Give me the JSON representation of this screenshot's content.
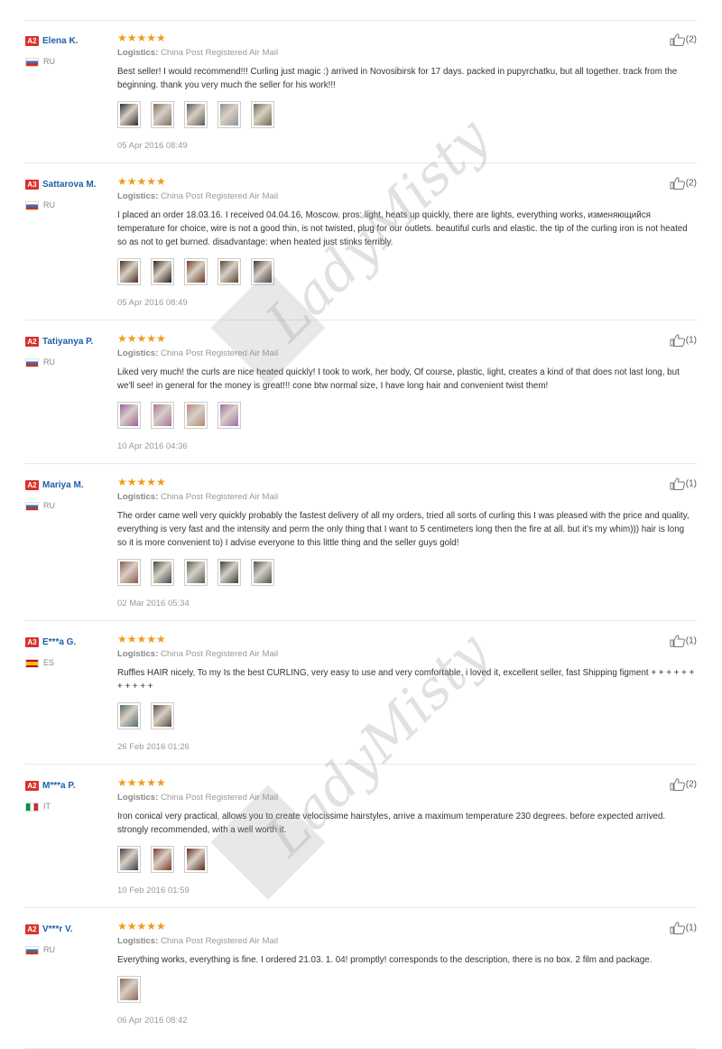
{
  "watermark_text": "LadyMisty",
  "reviews": [
    {
      "level": "A2",
      "name": "Elena K.",
      "country": "RU",
      "flag": "ru",
      "stars": "★★★★★",
      "logistics_label": "Logistics:",
      "logistics": "China Post Registered Air Mail",
      "text": "Best seller! I would recommend!!! Curling just magic :) arrived in Novosibirsk for 17 days. packed in pupyrchatku, but all together. track from the beginning. thank you very much the seller for his work!!!",
      "thumbs": [
        "#2d2d2a",
        "#7b7062",
        "#5e5a52",
        "#8e9499",
        "#6f6a4c"
      ],
      "date": "05 Apr 2016 08:49",
      "likes": "(2)"
    },
    {
      "level": "A3",
      "name": "Sattarova M.",
      "country": "RU",
      "flag": "ru",
      "stars": "★★★★★",
      "logistics_label": "Logistics:",
      "logistics": "China Post Registered Air Mail",
      "text": "I placed an order 18.03.16. I received 04.04.16, Moscow. pros: light, heats up quickly, there are lights, everything works, изменяющийся temperature for choice, wire is not a good thin, is not twisted, plug for our outlets. beautiful curls and elastic. the tip of the curling iron is not heated so as not to get burned. disadvantage: when heated just stinks terribly.",
      "thumbs": [
        "#4a3020",
        "#2a211c",
        "#6a3e26",
        "#5a4535",
        "#3a3436"
      ],
      "date": "05 Apr 2016 08:49",
      "likes": "(2)"
    },
    {
      "level": "A2",
      "name": "Tatiyanya P.",
      "country": "RU",
      "flag": "ru",
      "stars": "★★★★★",
      "logistics_label": "Logistics:",
      "logistics": "China Post Registered Air Mail",
      "text": "Liked very much! the curls are nice heated quickly! I took to work, her body, Of course, plastic, light, creates a kind of that does not last long, but we'll see! in general for the money is great!!! cone btw normal size, I have long hair and convenient twist them!",
      "thumbs": [
        "#9a5f9a",
        "#a9739d",
        "#b4877a",
        "#9d6ea8"
      ],
      "date": "10 Apr 2016 04:36",
      "likes": "(1)"
    },
    {
      "level": "A2",
      "name": "Mariya M.",
      "country": "RU",
      "flag": "ru",
      "stars": "★★★★★",
      "logistics_label": "Logistics:",
      "logistics": "China Post Registered Air Mail",
      "text": "The order came well very quickly probably the fastest delivery of all my orders, tried all sorts of curling this I was pleased with the price and quality, everything is very fast and the intensity and perm the only thing that I want to 5 centimeters long then the fire at all. but it's my whim))) hair is long so it is more convenient to) I advise everyone to this little thing and the seller guys gold!",
      "thumbs": [
        "#8b5a4a",
        "#3f4a45",
        "#55605a",
        "#3a3f3c",
        "#4c5552"
      ],
      "date": "02 Mar 2016 05:34",
      "likes": "(1)"
    },
    {
      "level": "A3",
      "name": "E***a G.",
      "country": "ES",
      "flag": "es",
      "stars": "★★★★★",
      "logistics_label": "Logistics:",
      "logistics": "China Post Registered Air Mail",
      "text": "Ruffles HAIR nicely, To my Is the best CURLING, very easy to use and very comfortable, i loved it, excellent seller, fast Shipping figment + + + + + + + + + + +",
      "thumbs": [
        "#556b6b",
        "#5a4a3c"
      ],
      "date": "26 Feb 2016 01:26",
      "likes": "(1)"
    },
    {
      "level": "A2",
      "name": "M***a P.",
      "country": "IT",
      "flag": "it",
      "stars": "★★★★★",
      "logistics_label": "Logistics:",
      "logistics": "China Post Registered Air Mail",
      "text": "Iron conical very practical, allows you to create velocissime hairstyles, arrive a maximum temperature 230 degrees. before expected arrived. strongly recommended, with a well worth it.",
      "thumbs": [
        "#3c3f45",
        "#7a3a2a",
        "#5a2d20"
      ],
      "date": "10 Feb 2016 01:59",
      "likes": "(2)"
    },
    {
      "level": "A2",
      "name": "V***r V.",
      "country": "RU",
      "flag": "ru",
      "stars": "★★★★★",
      "logistics_label": "Logistics:",
      "logistics": "China Post Registered Air Mail",
      "text": "Everything works, everything is fine. I ordered 21.03. 1. 04! promptly! corresponds to the description, there is no box. 2 film and package.",
      "thumbs": [
        "#8a6a55"
      ],
      "date": "06 Apr 2016 08:42",
      "likes": "(1)"
    }
  ]
}
